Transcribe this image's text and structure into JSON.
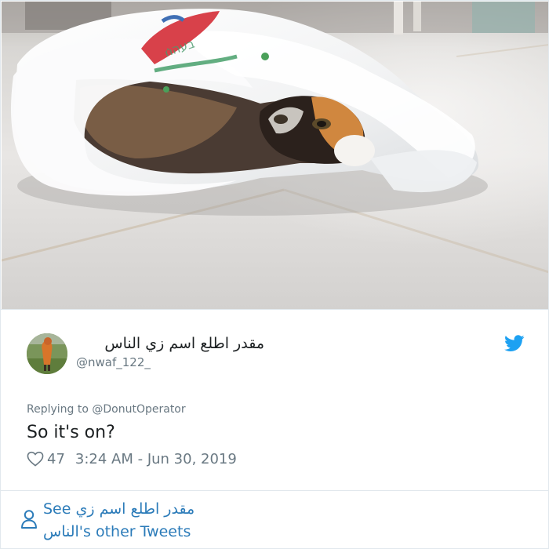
{
  "tweet": {
    "display_name": "مقدر اطلع اسم زي الناس",
    "handle": "@nwaf_122_",
    "replying_to": "Replying to @DonutOperator",
    "text": "So it's on?",
    "like_count": "47",
    "timestamp": "3:24 AM - Jun 30, 2019",
    "icons": {
      "brand": "twitter-bird-icon",
      "like": "heart-icon",
      "profile": "person-icon"
    }
  },
  "footer": {
    "other_tweets_line1": "See مقدر اطلع اسم زي",
    "other_tweets_line2": "الناس's other Tweets"
  },
  "colors": {
    "brand_blue": "#1da1f2",
    "link_blue": "#2b7bb9",
    "secondary_text": "#697882",
    "primary_text": "#1c2022",
    "border": "#e1e8ed"
  }
}
